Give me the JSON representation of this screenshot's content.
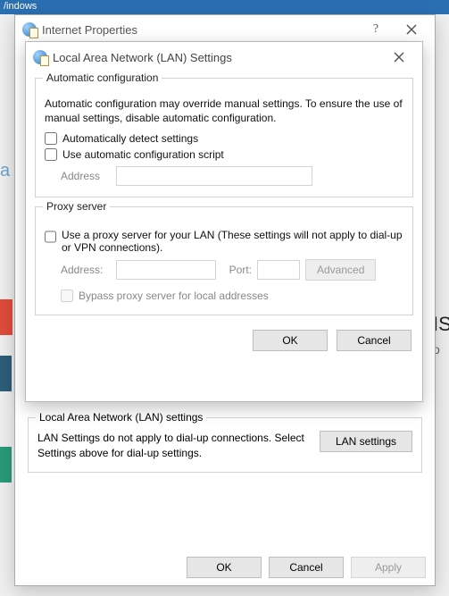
{
  "bg_top": "/indows",
  "parent": {
    "title": "Internet Properties",
    "lan_section": {
      "legend": "Local Area Network (LAN) settings",
      "text": "LAN Settings do not apply to dial-up connections. Select Settings above for dial-up settings.",
      "button": "LAN settings"
    },
    "buttons": {
      "ok": "OK",
      "cancel": "Cancel",
      "apply": "Apply"
    }
  },
  "dialog": {
    "title": "Local Area Network (LAN) Settings",
    "auto": {
      "legend": "Automatic configuration",
      "desc": "Automatic configuration may override manual settings.  To ensure the use of manual settings, disable automatic configuration.",
      "cb_detect": "Automatically detect settings",
      "cb_script": "Use automatic configuration script",
      "address_label": "Address",
      "address_value": ""
    },
    "proxy": {
      "legend": "Proxy server",
      "cb_use": "Use a proxy server for your LAN (These settings will not apply to dial-up or VPN connections).",
      "address_label": "Address:",
      "address_value": "",
      "port_label": "Port:",
      "port_value": "",
      "advanced": "Advanced",
      "cb_bypass": "Bypass proxy server for local addresses"
    },
    "buttons": {
      "ok": "OK",
      "cancel": "Cancel"
    }
  }
}
